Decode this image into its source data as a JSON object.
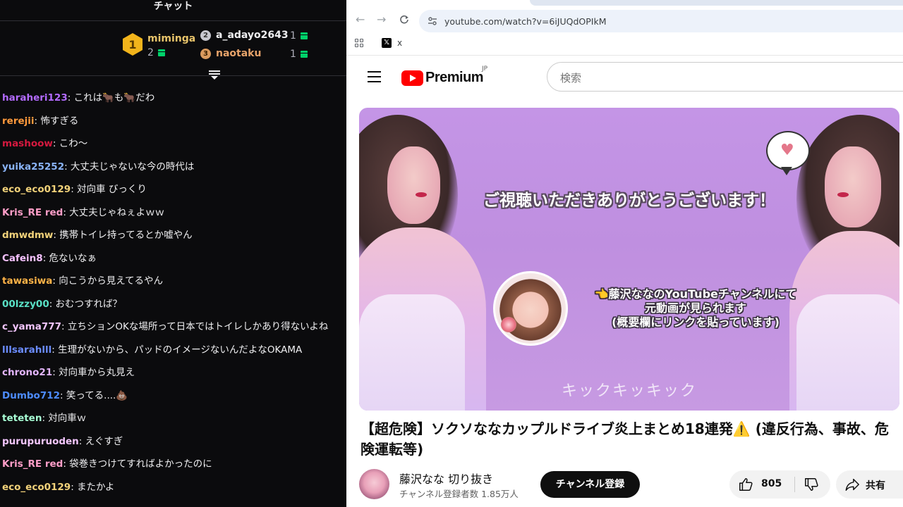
{
  "chat": {
    "title": "チャット",
    "leaderboard": [
      {
        "rank": "1",
        "name": "miminga",
        "count": "2",
        "color": "#e7c36a"
      },
      {
        "rank": "2",
        "name": "a_adayo2643",
        "count": "1",
        "color": "#efeff1"
      },
      {
        "rank": "3",
        "name": "naotaku",
        "count": "1",
        "color": "#e7a36a"
      }
    ],
    "messages": [
      {
        "user": "haraheri123",
        "text": ": これは🐂も🐂だわ",
        "color": "#b36bff"
      },
      {
        "user": "rerejii",
        "text": ": 怖すぎる",
        "color": "#ff9a3c"
      },
      {
        "user": "mashoow",
        "text": ": こわ〜",
        "color": "#d6193f"
      },
      {
        "user": "yuika25252",
        "text": ": 大丈夫じゃないな今の時代は",
        "color": "#8ab4f8"
      },
      {
        "user": "eco_eco0129",
        "text": ": 対向車 びっくり",
        "color": "#f2d27a"
      },
      {
        "user": "Kris_RE red",
        "text": ": 大丈夫じゃねぇよｗｗ",
        "color": "#ff9ec8"
      },
      {
        "user": "dmwdmw",
        "text": ": 携帯トイレ持ってるとか嘘やん",
        "color": "#f2d27a"
      },
      {
        "user": "Cafein8",
        "text": ": 危ないなぁ",
        "color": "#f6c1ff"
      },
      {
        "user": "tawasiwa",
        "text": ": 向こうから見えてるやん",
        "color": "#ffb347"
      },
      {
        "user": "00lzzy00",
        "text": ": おむつすれば？",
        "color": "#59e0c5"
      },
      {
        "user": "c_yama777",
        "text": ": 立ちションOKな場所って日本ではトイレしかあり得ないよね",
        "color": "#f4c6ff"
      },
      {
        "user": "lllsarahlll",
        "text": ": 生理がないから、パッドのイメージないんだよなOKAMA",
        "color": "#6b8cff"
      },
      {
        "user": "chrono21",
        "text": ": 対向車から丸見え",
        "color": "#e4b6ff"
      },
      {
        "user": "Dumbo712",
        "text": ": 笑ってる....💩",
        "color": "#4d8cff"
      },
      {
        "user": "teteten",
        "text": ": 対向車ｗ",
        "color": "#a8ffd5"
      },
      {
        "user": "purupuruoden",
        "text": ": えぐすぎ",
        "color": "#f4c6ff"
      },
      {
        "user": "Kris_RE red",
        "text": ": 袋巻きつけてすればよかったのに",
        "color": "#ff9ec8"
      },
      {
        "user": "eco_eco0129",
        "text": ": またかよ",
        "color": "#f2d27a"
      }
    ]
  },
  "browser": {
    "url": "youtube.com/watch?v=6iJUQdOPIkM",
    "bookmark_x": "x"
  },
  "youtube": {
    "brand": "Premium",
    "region": "JP",
    "search_placeholder": "検索",
    "video": {
      "overlay_thanks": "ご視聴いただきありがとうございます！",
      "overlay_promo_1": "👈藤沢ななのYouTubeチャンネルにて",
      "overlay_promo_2": "元動画が見られます",
      "overlay_promo_3": "(概要欄にリンクを貼っています)",
      "overlay_kick": "キックキッキック"
    },
    "title": "【超危険】ソクソななカップルドライブ炎上まとめ18連発⚠️ (違反行為、事故、危険運転等)",
    "channel_name": "藤沢なな 切り抜き",
    "channel_subs": "チャンネル登録者数 1.85万人",
    "subscribe_label": "チャンネル登録",
    "like_count": "805",
    "share_label": "共有"
  }
}
